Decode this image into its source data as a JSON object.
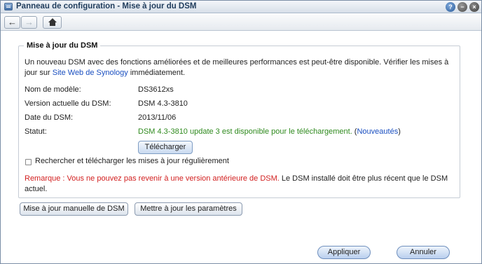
{
  "window": {
    "title": "Panneau de configuration - Mise à jour du DSM",
    "help_glyph": "?",
    "min_glyph": "−",
    "close_glyph": "×"
  },
  "toolbar": {
    "back_glyph": "←",
    "forward_glyph": "→"
  },
  "section": {
    "legend": "Mise à jour du DSM",
    "intro_text": "Un nouveau DSM avec des fonctions améliorées et de meilleures performances est peut-être disponible. Vérifier les mises à jour sur ",
    "intro_link": "Site Web de Synology",
    "intro_suffix": " immédiatement."
  },
  "info": {
    "model_label": "Nom de modèle:",
    "model_value": "DS3612xs",
    "version_label": "Version actuelle du DSM:",
    "version_value": "DSM 4.3-3810",
    "date_label": "Date du DSM:",
    "date_value": "2013/11/06",
    "status_label": "Statut:",
    "status_value": "DSM 4.3-3810 update 3 est disponible pour le téléchargement.",
    "status_open": " (",
    "status_link": "Nouveautés",
    "status_close": ")"
  },
  "buttons": {
    "download": "Télécharger",
    "manual_update": "Mise à jour manuelle de DSM",
    "update_settings": "Mettre à jour les paramètres",
    "apply": "Appliquer",
    "cancel": "Annuler"
  },
  "auto_check": {
    "label": "Rechercher et télécharger les mises à jour régulièrement",
    "checked": false
  },
  "remark": {
    "warning": "Remarque : Vous ne pouvez pas revenir à une version antérieure de DSM.",
    "note": " Le DSM installé doit être plus récent que le DSM actuel."
  },
  "colors": {
    "status_green": "#2f8a1e",
    "warning_red": "#d22020",
    "link_blue": "#1a4fc0"
  }
}
